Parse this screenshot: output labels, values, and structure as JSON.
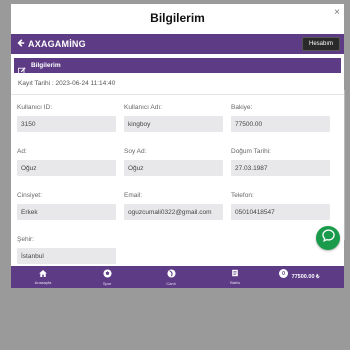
{
  "modal": {
    "title": "Bilgilerim",
    "close_label": "×"
  },
  "brand": {
    "name": "AXAGAMİNG",
    "account_button": "Hesabım"
  },
  "section": {
    "title": "Bilgilerim",
    "registration": "Kayıt Tarihi : 2023-06-24 11:14:40"
  },
  "fields": {
    "user_id": {
      "label": "Kullanıcı ID:",
      "value": "3150"
    },
    "username": {
      "label": "Kullanıcı Adı:",
      "value": "kingboy"
    },
    "balance": {
      "label": "Bakiye:",
      "value": "77500.00"
    },
    "first_name": {
      "label": "Ad:",
      "value": "Oğuz"
    },
    "last_name": {
      "label": "Soy Ad:",
      "value": "Oğuz"
    },
    "birth_date": {
      "label": "Doğum Tarihi:",
      "value": "27.03.1987"
    },
    "gender": {
      "label": "Cinsiyet:",
      "value": "Erkek"
    },
    "email": {
      "label": "Email:",
      "value": "oguzcumali0322@gmail.com"
    },
    "phone": {
      "label": "Telefon:",
      "value": "05010418547"
    },
    "city": {
      "label": "Şehir:",
      "value": "İstanbul"
    }
  },
  "bottom_nav": {
    "items": [
      {
        "label": "Anasayfa",
        "icon": "home-icon"
      },
      {
        "label": "Spor",
        "icon": "soccer-ball-icon"
      },
      {
        "label": "Canlı",
        "icon": "live-icon"
      },
      {
        "label": "Bahis",
        "icon": "bet-slip-icon"
      }
    ],
    "badge": "0",
    "balance": "77500.00 ₺"
  },
  "colors": {
    "primary": "#5e3c85",
    "field_bg": "#e8e8ea",
    "chat_fab": "#1a9a4b"
  }
}
